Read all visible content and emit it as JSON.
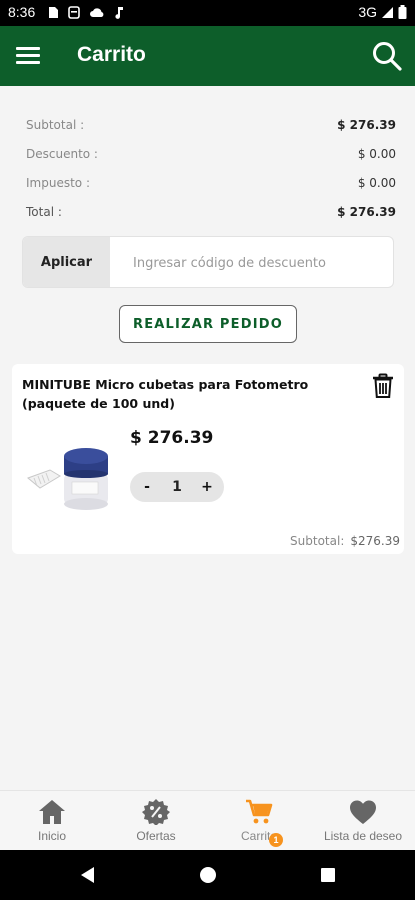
{
  "status_bar": {
    "time": "8:36",
    "network": "3G",
    "icons": [
      "sim-card-icon",
      "storage-icon",
      "cloud-icon",
      "music-note-icon",
      "signal-icon",
      "battery-icon"
    ]
  },
  "app_bar": {
    "title": "Carrito",
    "icons": [
      "menu-icon",
      "search-icon"
    ]
  },
  "summary": {
    "subtotal_label": "Subtotal :",
    "subtotal_value": "$ 276.39",
    "discount_label": "Descuento :",
    "discount_value": "$ 0.00",
    "tax_label": "Impuesto :",
    "tax_value": "$ 0.00",
    "total_label": "Total :",
    "total_value": "$ 276.39"
  },
  "coupon": {
    "apply_label": "Aplicar",
    "placeholder": "Ingresar código de descuento",
    "value": ""
  },
  "order_button": "REALIZAR PEDIDO",
  "cart_items": [
    {
      "name": "MINITUBE Micro cubetas para Fotometro (paquete de 100 und)",
      "price": "$ 276.39",
      "quantity": "1",
      "minus": "-",
      "plus": "+",
      "subtotal_label": "Subtotal:",
      "subtotal_value": "$276.39"
    }
  ],
  "bottom_nav": {
    "items": [
      {
        "label": "Inicio",
        "icon": "home-icon"
      },
      {
        "label": "Ofertas",
        "icon": "discount-icon"
      },
      {
        "label": "Carrito",
        "icon": "cart-icon",
        "active": true,
        "badge": "1"
      },
      {
        "label": "Lista de deseo",
        "icon": "heart-icon"
      }
    ]
  },
  "colors": {
    "primary": "#0d5e2a",
    "accent": "#f7931e",
    "background": "#f4f4f4"
  }
}
